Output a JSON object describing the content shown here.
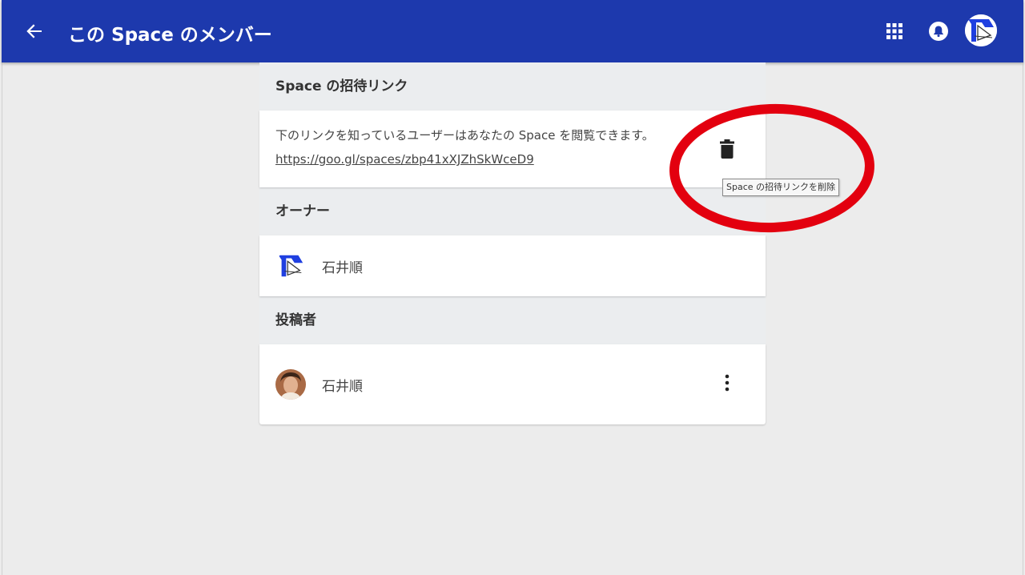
{
  "appbar": {
    "title": "この Space のメンバー",
    "background": "#1d39ad",
    "back_icon": "arrow-back-icon",
    "apps_icon": "apps-grid-icon",
    "notifications_icon": "bell-icon"
  },
  "invite": {
    "header": "Space の招待リンク",
    "description": "下のリンクを知っているユーザーはあなたの Space を閲覧できます。",
    "link": "https://goo.gl/spaces/zbp41xXJZhSkWceD9",
    "delete_icon": "trash-icon",
    "tooltip": "Space の招待リンクを削除"
  },
  "owner": {
    "header": "オーナー",
    "name": "石井順"
  },
  "posters": {
    "header": "投稿者",
    "items": [
      {
        "name": "石井順",
        "more_icon": "more-vert-icon"
      }
    ]
  },
  "annotation": {
    "shape": "ellipse",
    "color": "#e3000f"
  }
}
